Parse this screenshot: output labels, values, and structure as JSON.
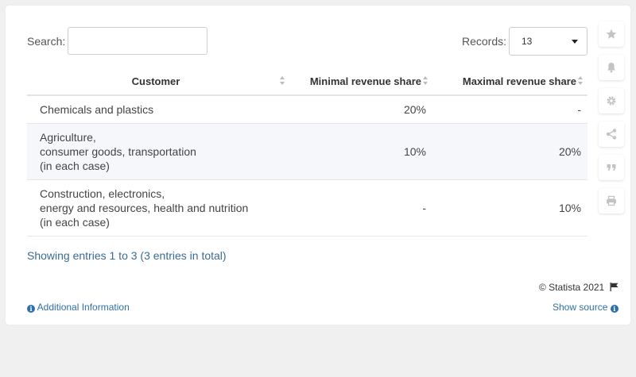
{
  "search": {
    "label": "Search:",
    "value": "",
    "placeholder": ""
  },
  "records": {
    "label": "Records:",
    "selected": "13"
  },
  "table": {
    "headers": [
      "Customer",
      "Minimal revenue share",
      "Maximal revenue share"
    ],
    "rows": [
      {
        "customer": [
          "Chemicals and plastics"
        ],
        "min": "20%",
        "max": "-"
      },
      {
        "customer": [
          "Agriculture,",
          "consumer goods, transportation",
          "(in each case)"
        ],
        "min": "10%",
        "max": "20%"
      },
      {
        "customer": [
          "Construction, electronics,",
          "energy and resources, health and nutrition",
          "(in each case)"
        ],
        "min": "-",
        "max": "10%"
      }
    ]
  },
  "footer": {
    "showing": "Showing entries 1 to 3 (3 entries in total)",
    "copyright": "© Statista 2021",
    "additional_info": "Additional Information",
    "show_source": "Show source"
  },
  "sidebar": {
    "icons": [
      "star-icon",
      "bell-icon",
      "gear-icon",
      "share-icon",
      "quote-icon",
      "print-icon"
    ]
  },
  "colors": {
    "link": "#2f6fa8",
    "showing_text": "#3a6b94",
    "striped_row": "#f5f7fa",
    "sidebar_icon": "#c3c3c3"
  }
}
